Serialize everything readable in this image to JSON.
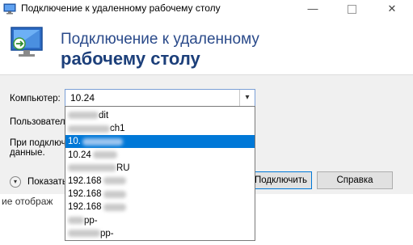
{
  "window": {
    "title": "Подключение к удаленному рабочему столу",
    "minimize": "—",
    "close": "✕"
  },
  "banner": {
    "line1": "Подключение к удаленному",
    "line2": "рабочему столу"
  },
  "form": {
    "computer_label": "Компьютер:",
    "computer_value": "10.24",
    "user_label": "Пользователь",
    "note_line1": "При подключе",
    "note_line2": "данные.",
    "show_options": "Показать"
  },
  "buttons": {
    "connect": "Подключить",
    "help": "Справка"
  },
  "background_text": "ие отображ",
  "dropdown": {
    "items": [
      {
        "text": "dit"
      },
      {
        "text": "ch1"
      },
      {
        "text": "10.",
        "selected": true
      },
      {
        "text": "10.24"
      },
      {
        "text": "RU"
      },
      {
        "text": "192.168"
      },
      {
        "text": "192.168"
      },
      {
        "text": "192.168"
      },
      {
        "text": "pp-"
      },
      {
        "text": "pp-"
      }
    ]
  },
  "colors": {
    "accent": "#0078d7",
    "banner_text": "#1c3f7a"
  }
}
